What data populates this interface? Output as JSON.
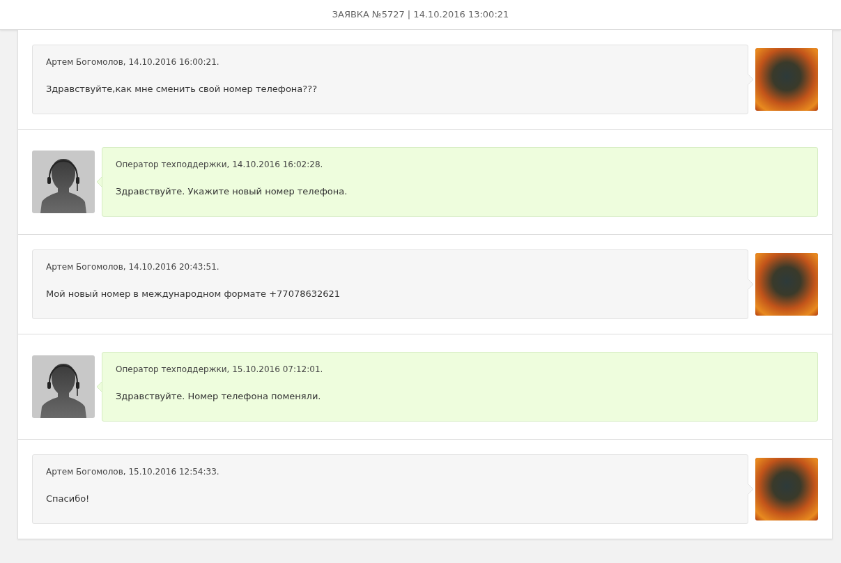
{
  "header": {
    "title": "ЗАЯВКА №5727 | 14.10.2016 13:00:21"
  },
  "messages": [
    {
      "kind": "user",
      "author_line": "Артем Богомолов, 14.10.2016 16:00:21.",
      "text": "Здравствуйте,как мне сменить свой номер телефона???"
    },
    {
      "kind": "operator",
      "author_line": "Оператор техподдержки, 14.10.2016 16:02:28.",
      "text": "Здравствуйте. Укажите новый номер телефона."
    },
    {
      "kind": "user",
      "author_line": "Артем Богомолов, 14.10.2016 20:43:51.",
      "text": "Мой новый номер в международном формате +77078632621"
    },
    {
      "kind": "operator",
      "author_line": "Оператор техподдержки, 15.10.2016 07:12:01.",
      "text": "Здравствуйте. Номер телефона поменяли."
    },
    {
      "kind": "user",
      "author_line": "Артем Богомолов, 15.10.2016 12:54:33.",
      "text": "Спасибо!"
    }
  ]
}
